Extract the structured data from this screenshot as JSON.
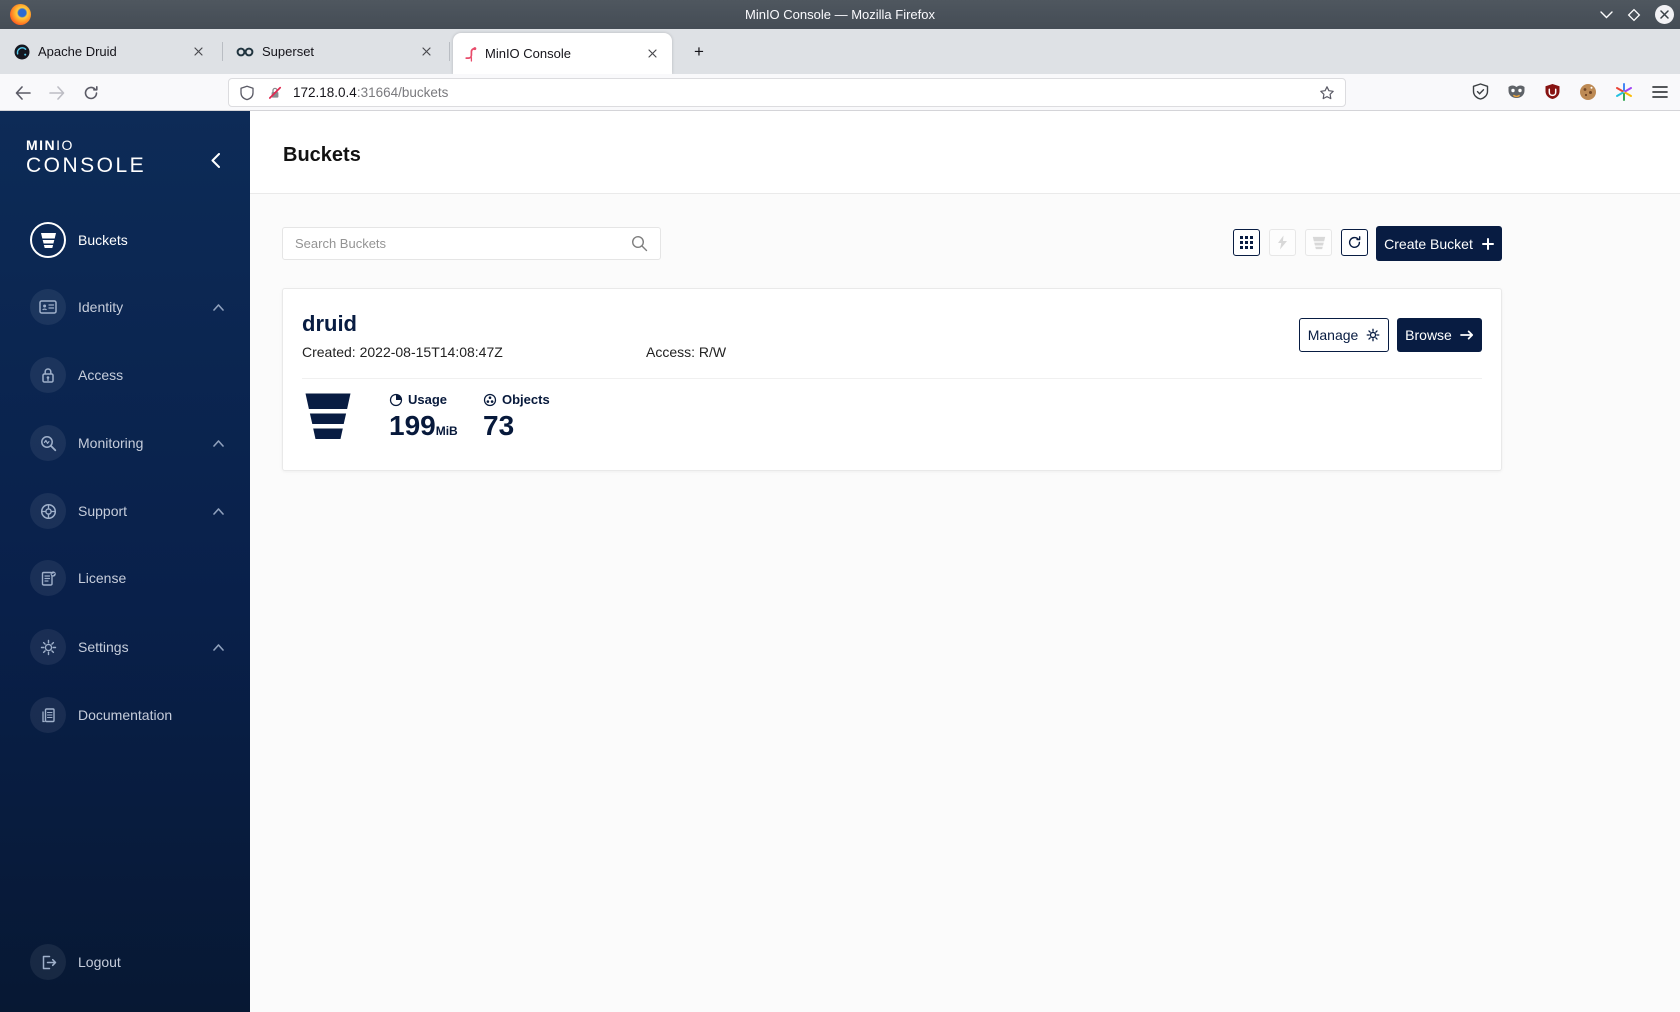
{
  "titlebar": {
    "title": "MinIO Console — Mozilla Firefox"
  },
  "tabs": {
    "items": [
      {
        "label": "Apache Druid"
      },
      {
        "label": "Superset"
      },
      {
        "label": "MinIO Console"
      }
    ],
    "new_tab": "+"
  },
  "urlbar": {
    "host": "172.18.0.4",
    "path": ":31664/buckets"
  },
  "sidebar": {
    "logo_bold": "MIN",
    "logo_light": "IO",
    "logo_subtitle": "CONSOLE",
    "items": [
      {
        "label": "Buckets",
        "active": true
      },
      {
        "label": "Identity",
        "expandable": true
      },
      {
        "label": "Access"
      },
      {
        "label": "Monitoring",
        "expandable": true
      },
      {
        "label": "Support",
        "expandable": true
      },
      {
        "label": "License"
      },
      {
        "label": "Settings",
        "expandable": true
      },
      {
        "label": "Documentation"
      }
    ],
    "logout_label": "Logout"
  },
  "main": {
    "page_title": "Buckets",
    "search_placeholder": "Search Buckets",
    "create_bucket_label": "Create Bucket",
    "bucket": {
      "name": "druid",
      "created": "Created: 2022-08-15T14:08:47Z",
      "access": "Access: R/W",
      "manage_label": "Manage",
      "browse_label": "Browse",
      "usage_label": "Usage",
      "usage_value": "199",
      "usage_unit": "MiB",
      "objects_label": "Objects",
      "objects_value": "73"
    }
  },
  "colors": {
    "brand_navy": "#081C42",
    "sidebar_gradient_top": "#0D2B57",
    "sidebar_gradient_bottom": "#071833",
    "flamingo_pink": "#E84C6B",
    "ublock_red": "#871312",
    "insecure_slash_red": "#E22850"
  }
}
